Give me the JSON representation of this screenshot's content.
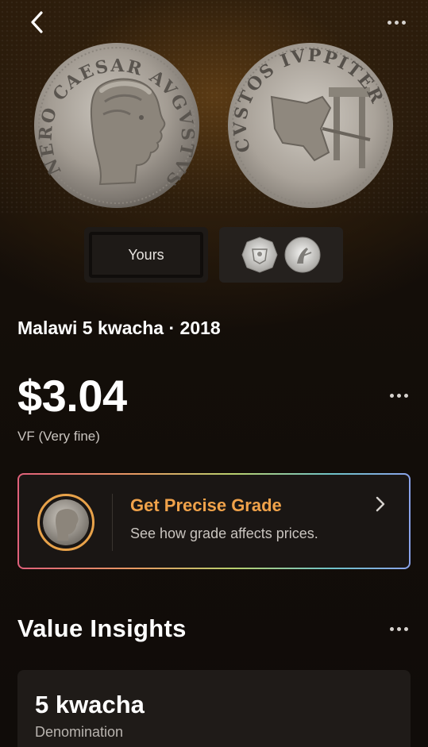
{
  "header": {
    "back_icon": "chevron-left-icon",
    "more_icon": "more-horizontal-icon"
  },
  "coin_images": {
    "obverse_legend": "NERO CAESAR AVGVSTVS",
    "reverse_legend": "CVSTOS IVPPITER"
  },
  "view_toggle": {
    "yours_label": "Yours",
    "reference_icon": "reference-coins-icon"
  },
  "coin": {
    "title": "Malawi 5 kwacha · 2018",
    "price": "$3.04",
    "grade": "VF (Very fine)"
  },
  "grade_card": {
    "title": "Get Precise Grade",
    "subtitle": "See how grade affects prices.",
    "accent_color": "#f0a24a"
  },
  "insights": {
    "title": "Value Insights",
    "cards": [
      {
        "value": "5 kwacha",
        "label": "Denomination"
      }
    ]
  }
}
